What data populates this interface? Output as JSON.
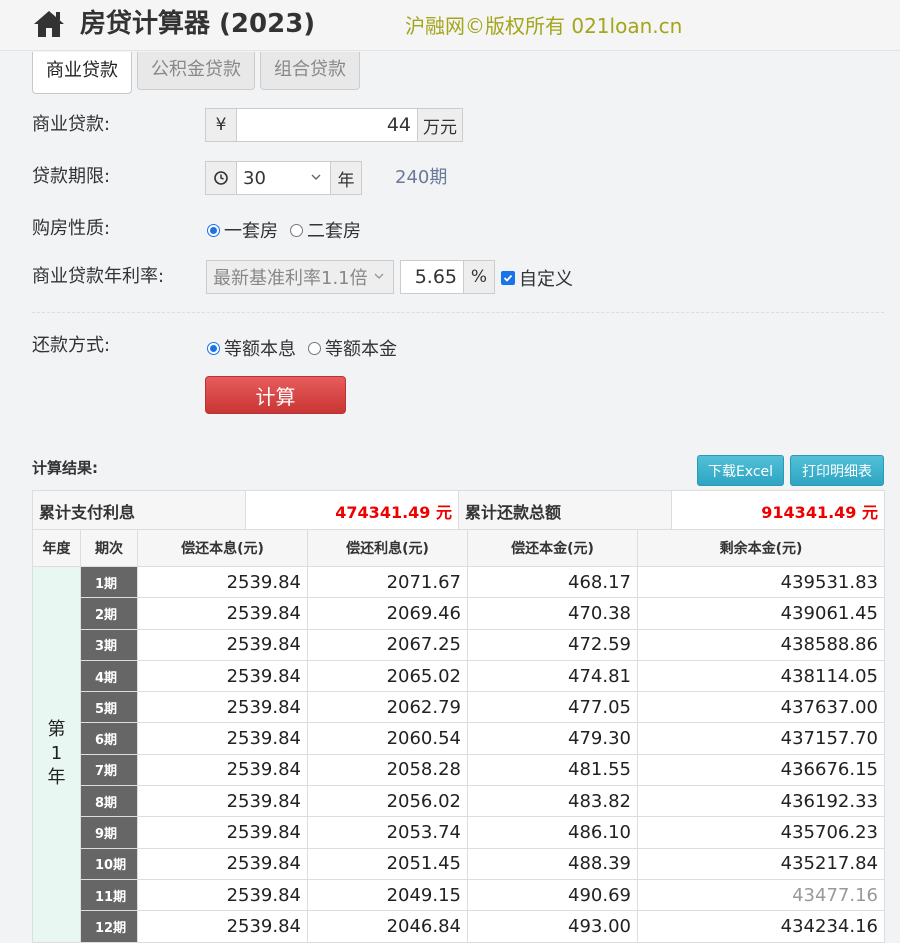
{
  "header": {
    "title": "房贷计算器 (2023)",
    "copyright": "沪融网©版权所有 021loan.cn"
  },
  "tabs": [
    "商业贷款",
    "公积金贷款",
    "组合贷款"
  ],
  "form": {
    "amount_label": "商业贷款:",
    "currency": "¥",
    "amount_value": "44",
    "amount_unit": "万元",
    "term_label": "贷款期限:",
    "term_value": "30",
    "term_unit": "年",
    "term_periods": "240期",
    "property_label": "购房性质:",
    "property_options": [
      "一套房",
      "二套房"
    ],
    "rate_label": "商业贷款年利率:",
    "rate_select": "最新基准利率1.1倍",
    "rate_value": "5.65",
    "rate_unit": "%",
    "custom_label": "自定义",
    "repay_label": "还款方式:",
    "repay_options": [
      "等额本息",
      "等额本金"
    ],
    "calc_button": "计算"
  },
  "results": {
    "title": "计算结果:",
    "excel_button": "下载Excel",
    "print_button": "打印明细表",
    "total_interest_label": "累计支付利息",
    "total_interest_value": "474341.49 元",
    "total_repay_label": "累计还款总额",
    "total_repay_value": "914341.49 元",
    "columns": [
      "年度",
      "期次",
      "偿还本息(元)",
      "偿还利息(元)",
      "偿还本金(元)",
      "剩余本金(元)"
    ],
    "year_label": [
      "第",
      "1",
      "年"
    ],
    "rows": [
      {
        "period": "1期",
        "payment": "2539.84",
        "interest": "2071.67",
        "principal": "468.17",
        "remaining": "439531.83"
      },
      {
        "period": "2期",
        "payment": "2539.84",
        "interest": "2069.46",
        "principal": "470.38",
        "remaining": "439061.45"
      },
      {
        "period": "3期",
        "payment": "2539.84",
        "interest": "2067.25",
        "principal": "472.59",
        "remaining": "438588.86"
      },
      {
        "period": "4期",
        "payment": "2539.84",
        "interest": "2065.02",
        "principal": "474.81",
        "remaining": "438114.05"
      },
      {
        "period": "5期",
        "payment": "2539.84",
        "interest": "2062.79",
        "principal": "477.05",
        "remaining": "437637.00"
      },
      {
        "period": "6期",
        "payment": "2539.84",
        "interest": "2060.54",
        "principal": "479.30",
        "remaining": "437157.70"
      },
      {
        "period": "7期",
        "payment": "2539.84",
        "interest": "2058.28",
        "principal": "481.55",
        "remaining": "436676.15"
      },
      {
        "period": "8期",
        "payment": "2539.84",
        "interest": "2056.02",
        "principal": "483.82",
        "remaining": "436192.33"
      },
      {
        "period": "9期",
        "payment": "2539.84",
        "interest": "2053.74",
        "principal": "486.10",
        "remaining": "435706.23"
      },
      {
        "period": "10期",
        "payment": "2539.84",
        "interest": "2051.45",
        "principal": "488.39",
        "remaining": "435217.84"
      },
      {
        "period": "11期",
        "payment": "2539.84",
        "interest": "2049.15",
        "principal": "490.69",
        "remaining": "43477.16"
      },
      {
        "period": "12期",
        "payment": "2539.84",
        "interest": "2046.84",
        "principal": "493.00",
        "remaining": "434234.16"
      }
    ]
  }
}
